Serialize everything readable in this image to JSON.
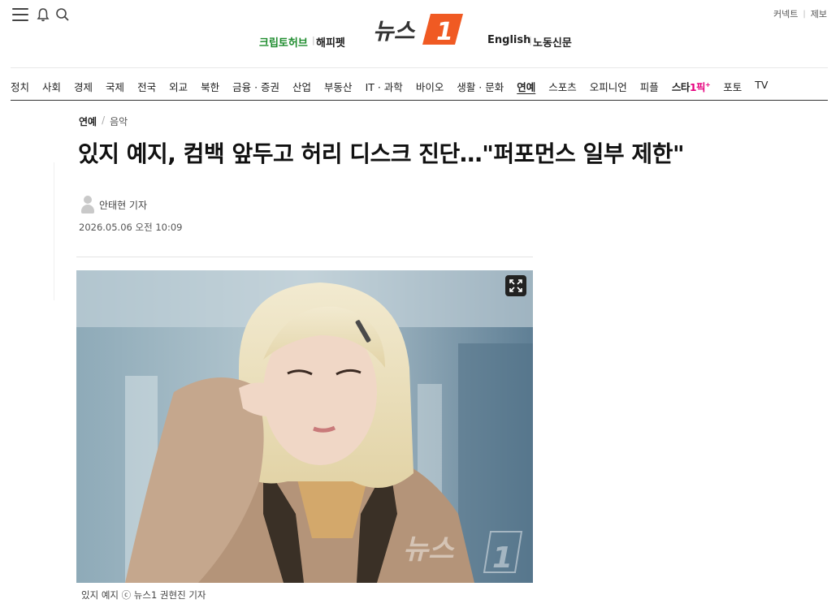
{
  "top_links": {
    "connect": "커넥트",
    "report": "제보"
  },
  "header": {
    "crypto_hub": "크립토허브",
    "happy_pet": "해피펫",
    "english": "English",
    "labor": "노동신문",
    "logo_text": "뉴스",
    "logo_number": "1"
  },
  "nav": {
    "items": [
      "정치",
      "사회",
      "경제",
      "국제",
      "전국",
      "외교",
      "북한",
      "금융 · 증권",
      "산업",
      "부동산",
      "IT · 과학",
      "바이오",
      "생활 · 문화",
      "연예",
      "스포츠",
      "오피니언",
      "피플"
    ],
    "star_prefix": "스타",
    "star_brand": "1픽",
    "star_mark": "+",
    "after": [
      "포토",
      "TV"
    ]
  },
  "breadcrumb": {
    "section": "연예",
    "subsection": "음악"
  },
  "article": {
    "title": "있지 예지, 컴백 앞두고 허리 디스크 진단…\"퍼포먼스 일부 제한\"",
    "author": "안태현 기자",
    "date": "2026.05.06 오전 10:09",
    "caption": "있지 예지 ⓒ 뉴스1 권현진 기자",
    "watermark_text": "뉴스",
    "watermark_number": "1"
  },
  "colors": {
    "brand_orange": "#f05a23",
    "green": "#1e8c2e",
    "pink": "#e6007e"
  }
}
